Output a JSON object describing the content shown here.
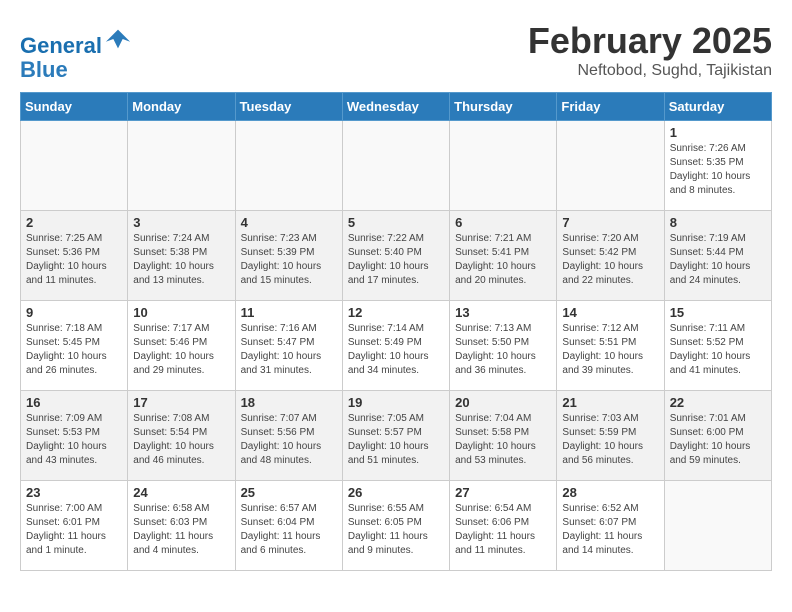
{
  "header": {
    "logo_line1": "General",
    "logo_line2": "Blue",
    "title": "February 2025",
    "subtitle": "Neftobod, Sughd, Tajikistan"
  },
  "days_of_week": [
    "Sunday",
    "Monday",
    "Tuesday",
    "Wednesday",
    "Thursday",
    "Friday",
    "Saturday"
  ],
  "weeks": [
    [
      {
        "num": "",
        "info": ""
      },
      {
        "num": "",
        "info": ""
      },
      {
        "num": "",
        "info": ""
      },
      {
        "num": "",
        "info": ""
      },
      {
        "num": "",
        "info": ""
      },
      {
        "num": "",
        "info": ""
      },
      {
        "num": "1",
        "info": "Sunrise: 7:26 AM\nSunset: 5:35 PM\nDaylight: 10 hours and 8 minutes."
      }
    ],
    [
      {
        "num": "2",
        "info": "Sunrise: 7:25 AM\nSunset: 5:36 PM\nDaylight: 10 hours and 11 minutes."
      },
      {
        "num": "3",
        "info": "Sunrise: 7:24 AM\nSunset: 5:38 PM\nDaylight: 10 hours and 13 minutes."
      },
      {
        "num": "4",
        "info": "Sunrise: 7:23 AM\nSunset: 5:39 PM\nDaylight: 10 hours and 15 minutes."
      },
      {
        "num": "5",
        "info": "Sunrise: 7:22 AM\nSunset: 5:40 PM\nDaylight: 10 hours and 17 minutes."
      },
      {
        "num": "6",
        "info": "Sunrise: 7:21 AM\nSunset: 5:41 PM\nDaylight: 10 hours and 20 minutes."
      },
      {
        "num": "7",
        "info": "Sunrise: 7:20 AM\nSunset: 5:42 PM\nDaylight: 10 hours and 22 minutes."
      },
      {
        "num": "8",
        "info": "Sunrise: 7:19 AM\nSunset: 5:44 PM\nDaylight: 10 hours and 24 minutes."
      }
    ],
    [
      {
        "num": "9",
        "info": "Sunrise: 7:18 AM\nSunset: 5:45 PM\nDaylight: 10 hours and 26 minutes."
      },
      {
        "num": "10",
        "info": "Sunrise: 7:17 AM\nSunset: 5:46 PM\nDaylight: 10 hours and 29 minutes."
      },
      {
        "num": "11",
        "info": "Sunrise: 7:16 AM\nSunset: 5:47 PM\nDaylight: 10 hours and 31 minutes."
      },
      {
        "num": "12",
        "info": "Sunrise: 7:14 AM\nSunset: 5:49 PM\nDaylight: 10 hours and 34 minutes."
      },
      {
        "num": "13",
        "info": "Sunrise: 7:13 AM\nSunset: 5:50 PM\nDaylight: 10 hours and 36 minutes."
      },
      {
        "num": "14",
        "info": "Sunrise: 7:12 AM\nSunset: 5:51 PM\nDaylight: 10 hours and 39 minutes."
      },
      {
        "num": "15",
        "info": "Sunrise: 7:11 AM\nSunset: 5:52 PM\nDaylight: 10 hours and 41 minutes."
      }
    ],
    [
      {
        "num": "16",
        "info": "Sunrise: 7:09 AM\nSunset: 5:53 PM\nDaylight: 10 hours and 43 minutes."
      },
      {
        "num": "17",
        "info": "Sunrise: 7:08 AM\nSunset: 5:54 PM\nDaylight: 10 hours and 46 minutes."
      },
      {
        "num": "18",
        "info": "Sunrise: 7:07 AM\nSunset: 5:56 PM\nDaylight: 10 hours and 48 minutes."
      },
      {
        "num": "19",
        "info": "Sunrise: 7:05 AM\nSunset: 5:57 PM\nDaylight: 10 hours and 51 minutes."
      },
      {
        "num": "20",
        "info": "Sunrise: 7:04 AM\nSunset: 5:58 PM\nDaylight: 10 hours and 53 minutes."
      },
      {
        "num": "21",
        "info": "Sunrise: 7:03 AM\nSunset: 5:59 PM\nDaylight: 10 hours and 56 minutes."
      },
      {
        "num": "22",
        "info": "Sunrise: 7:01 AM\nSunset: 6:00 PM\nDaylight: 10 hours and 59 minutes."
      }
    ],
    [
      {
        "num": "23",
        "info": "Sunrise: 7:00 AM\nSunset: 6:01 PM\nDaylight: 11 hours and 1 minute."
      },
      {
        "num": "24",
        "info": "Sunrise: 6:58 AM\nSunset: 6:03 PM\nDaylight: 11 hours and 4 minutes."
      },
      {
        "num": "25",
        "info": "Sunrise: 6:57 AM\nSunset: 6:04 PM\nDaylight: 11 hours and 6 minutes."
      },
      {
        "num": "26",
        "info": "Sunrise: 6:55 AM\nSunset: 6:05 PM\nDaylight: 11 hours and 9 minutes."
      },
      {
        "num": "27",
        "info": "Sunrise: 6:54 AM\nSunset: 6:06 PM\nDaylight: 11 hours and 11 minutes."
      },
      {
        "num": "28",
        "info": "Sunrise: 6:52 AM\nSunset: 6:07 PM\nDaylight: 11 hours and 14 minutes."
      },
      {
        "num": "",
        "info": ""
      }
    ]
  ]
}
